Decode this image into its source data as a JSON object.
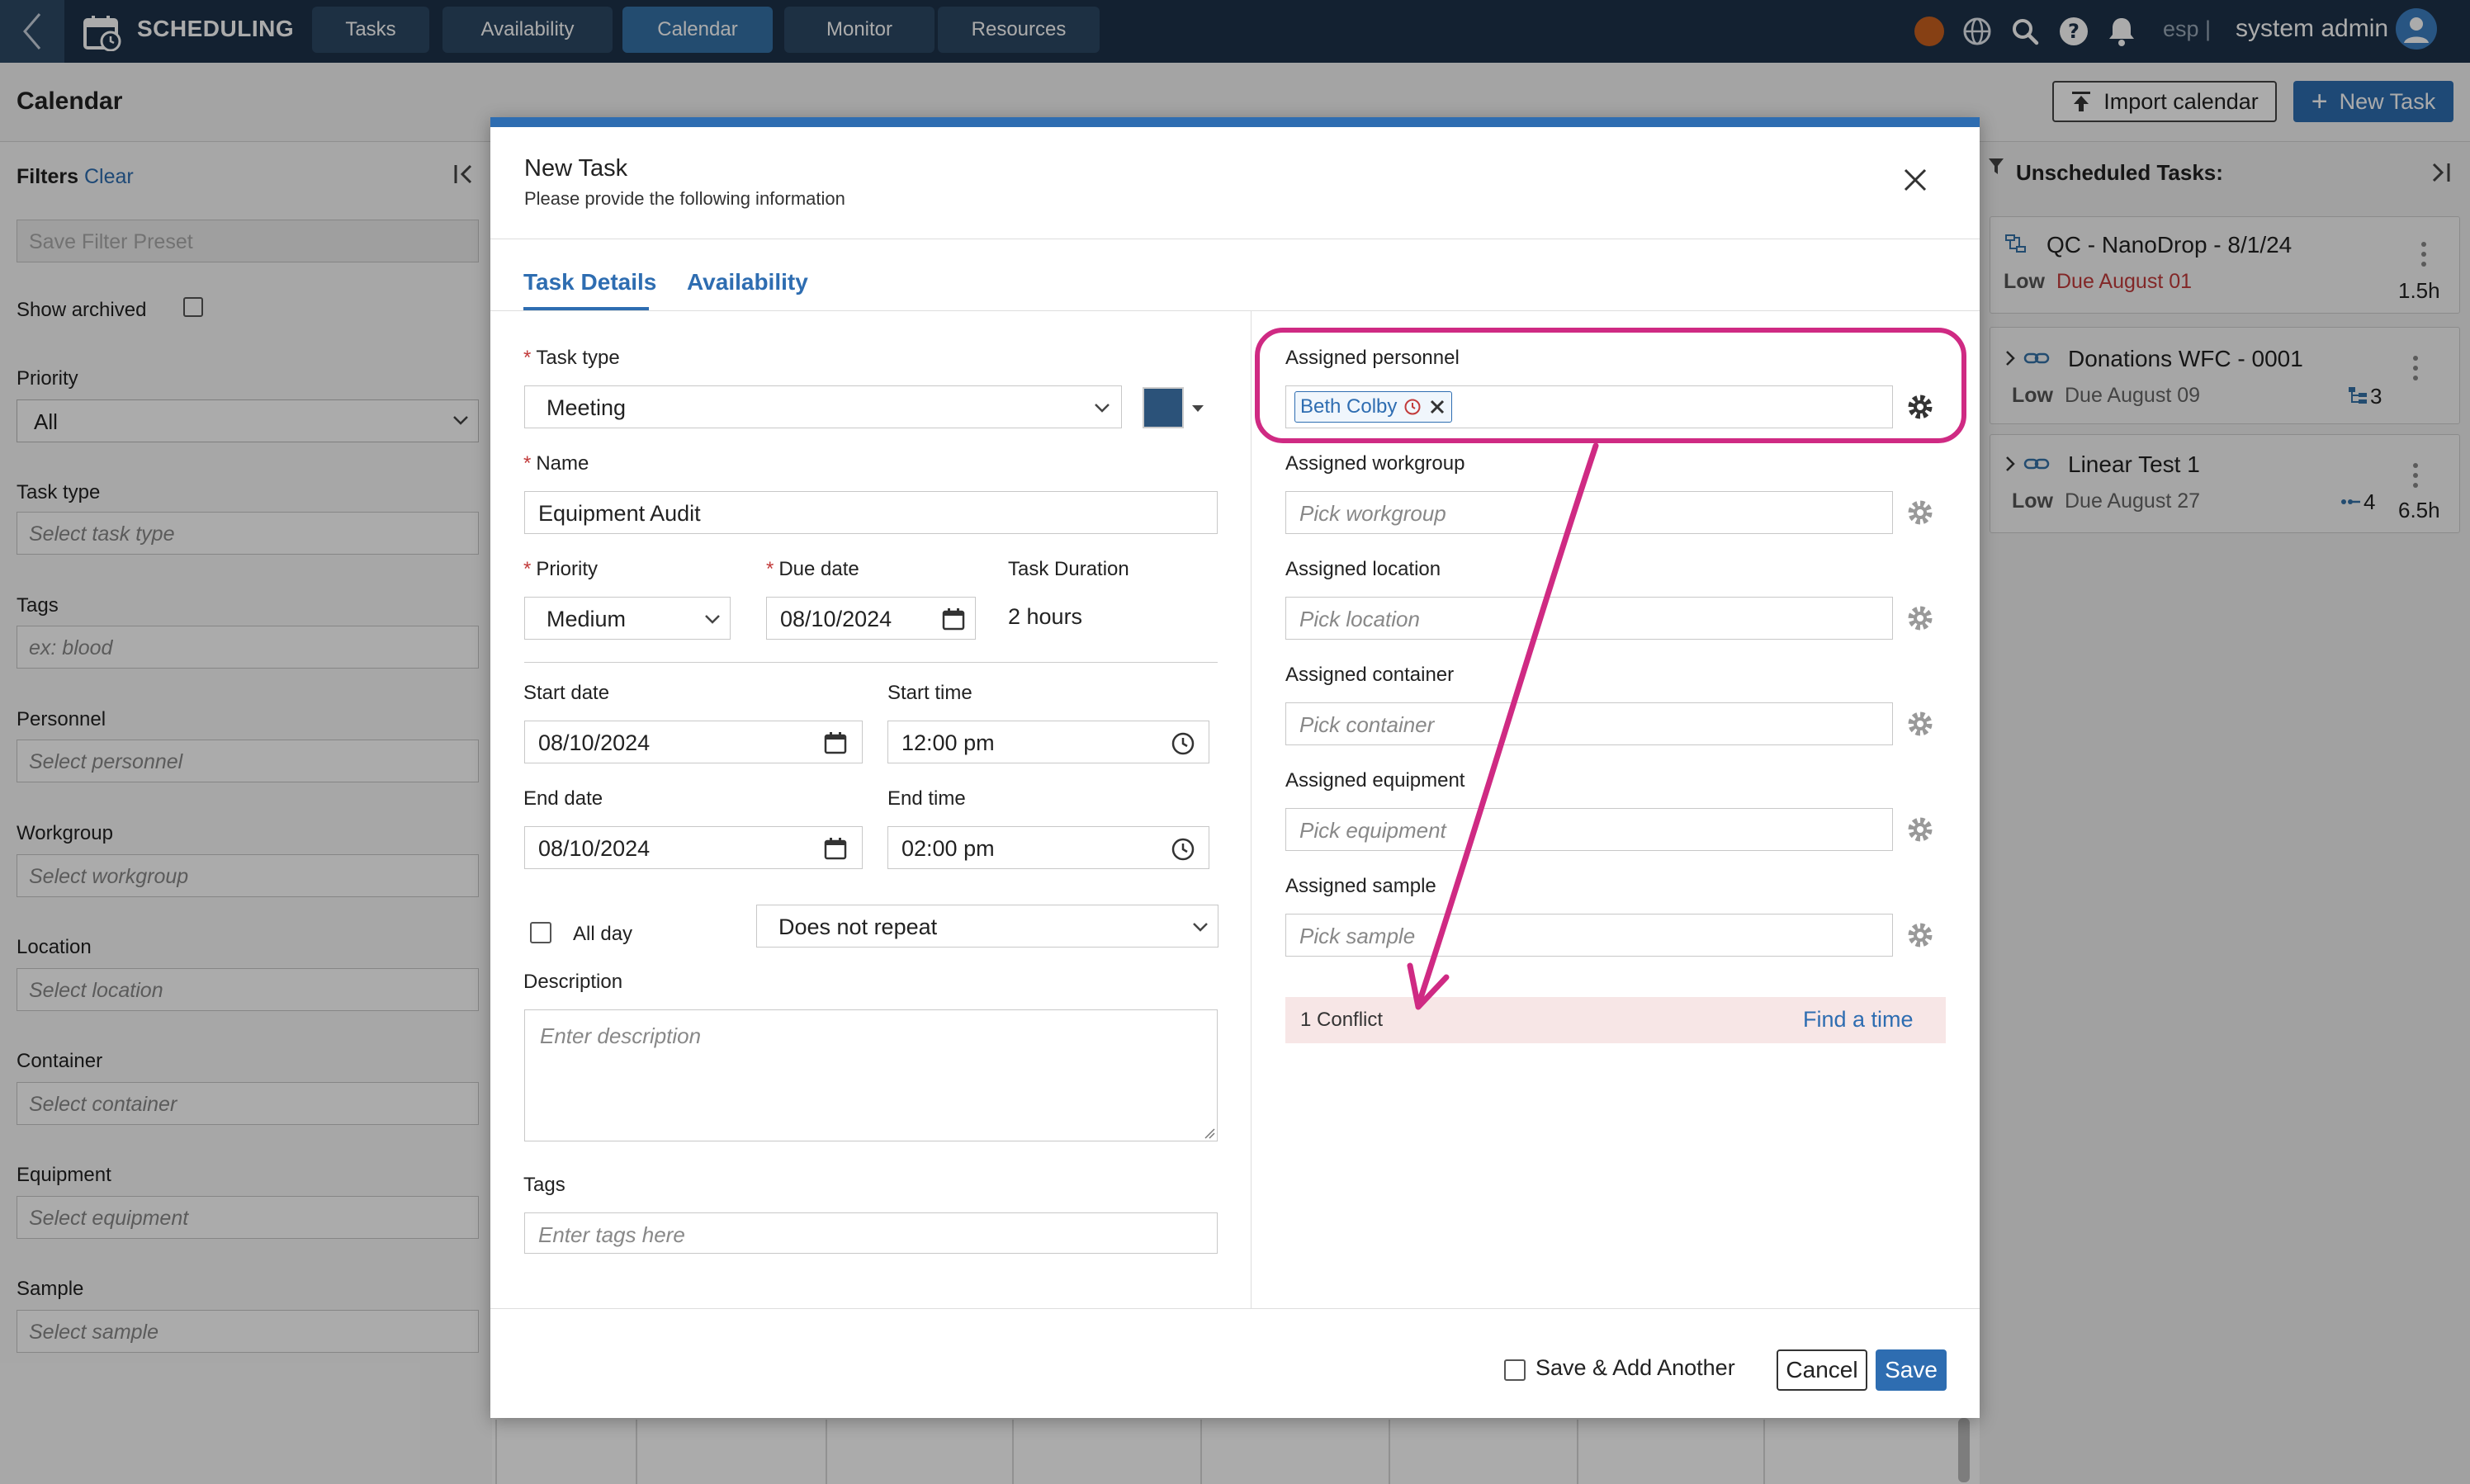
{
  "app": {
    "title": "SCHEDULING",
    "nav_tabs": [
      {
        "label": "Tasks"
      },
      {
        "label": "Availability"
      },
      {
        "label": "Calendar"
      },
      {
        "label": "Monitor"
      },
      {
        "label": "Resources"
      }
    ],
    "active_tab": "Calendar",
    "lang": "esp |",
    "user_name": "system admin"
  },
  "page": {
    "title": "Calendar",
    "import_label": "Import calendar",
    "new_task_label": "New Task"
  },
  "filters": {
    "title": "Filters",
    "clear_label": "Clear",
    "preset_placeholder": "Save Filter Preset",
    "show_archived_label": "Show archived",
    "priority_label": "Priority",
    "priority_value": "All",
    "fields": [
      {
        "label": "Task type",
        "placeholder": "Select task type"
      },
      {
        "label": "Tags",
        "placeholder": "ex: blood"
      },
      {
        "label": "Personnel",
        "placeholder": "Select personnel"
      },
      {
        "label": "Workgroup",
        "placeholder": "Select workgroup"
      },
      {
        "label": "Location",
        "placeholder": "Select location"
      },
      {
        "label": "Container",
        "placeholder": "Select container"
      },
      {
        "label": "Equipment",
        "placeholder": "Select equipment"
      },
      {
        "label": "Sample",
        "placeholder": "Select sample"
      }
    ]
  },
  "unscheduled": {
    "title": "Unscheduled Tasks:",
    "tasks": [
      {
        "name": "QC - NanoDrop - 8/1/24",
        "priority": "Low",
        "due": "Due August 01",
        "hours": "1.5h",
        "count": ""
      },
      {
        "name": "Donations WFC - 0001",
        "priority": "Low",
        "due": "Due August 09",
        "hours": "",
        "count": "3"
      },
      {
        "name": "Linear Test 1",
        "priority": "Low",
        "due": "Due August 27",
        "hours": "6.5h",
        "count": "4"
      }
    ]
  },
  "modal": {
    "title": "New Task",
    "subtitle": "Please provide the following information",
    "tabs": [
      "Task Details",
      "Availability"
    ],
    "task_type_label": "Task type",
    "task_type_value": "Meeting",
    "task_color": "#2b5279",
    "name_label": "Name",
    "name_value": "Equipment Audit",
    "priority_label": "Priority",
    "priority_value": "Medium",
    "due_label": "Due date",
    "due_value": "08/10/2024",
    "duration_label": "Task Duration",
    "duration_value": "2 hours",
    "start_date_label": "Start date",
    "start_date_value": "08/10/2024",
    "start_time_label": "Start time",
    "start_time_value": "12:00 pm",
    "end_date_label": "End date",
    "end_date_value": "08/10/2024",
    "end_time_label": "End time",
    "end_time_value": "02:00 pm",
    "all_day_label": "All day",
    "repeat_value": "Does not repeat",
    "description_label": "Description",
    "description_placeholder": "Enter description",
    "tags_label": "Tags",
    "tags_placeholder": "Enter tags here",
    "assigned": {
      "personnel_label": "Assigned personnel",
      "personnel_chip": "Beth Colby",
      "resources": [
        {
          "label": "Assigned workgroup",
          "placeholder": "Pick workgroup"
        },
        {
          "label": "Assigned location",
          "placeholder": "Pick location"
        },
        {
          "label": "Assigned container",
          "placeholder": "Pick container"
        },
        {
          "label": "Assigned equipment",
          "placeholder": "Pick equipment"
        },
        {
          "label": "Assigned sample",
          "placeholder": "Pick sample"
        }
      ]
    },
    "conflict_text": "1 Conflict",
    "find_time_label": "Find a time",
    "save_add_another_label": "Save & Add Another",
    "cancel_label": "Cancel",
    "save_label": "Save"
  },
  "colors": {
    "nav_bg": "#1d3249",
    "accent": "#2e6db1",
    "annotation": "#cf2a83",
    "conflict_bg": "#f7e6e6",
    "due_red": "#c23b3b"
  }
}
